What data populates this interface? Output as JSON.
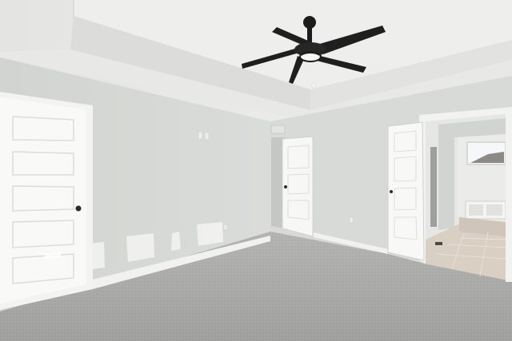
{
  "scene": {
    "description_colors": {
      "wall": "#d9dbd8",
      "wall_shadow": "#cfd1ce",
      "ceiling": "#ececea",
      "carpet": "#a9a9a7",
      "door": "#f7f7f6",
      "trim": "#f4f4f3",
      "fan": "#1f1f1f",
      "tile": "#d9cfc2"
    },
    "icons": [
      "ceiling-fan-icon",
      "door-knob-icon",
      "outlet-icon",
      "light-switch-icon",
      "vent-icon"
    ]
  }
}
